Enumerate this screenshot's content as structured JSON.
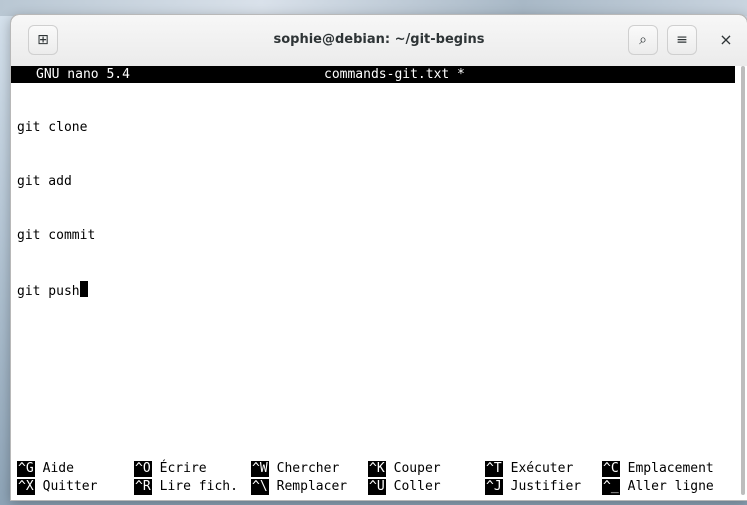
{
  "window": {
    "title": "sophie@debian: ~/git-begins"
  },
  "titlebar": {
    "new_tab_icon": "new-tab-icon",
    "search_icon": "search-icon",
    "menu_icon": "hamburger-menu-icon",
    "close_icon": "close-icon",
    "new_tab_glyph": "⊞",
    "search_glyph": "⌕",
    "menu_glyph": "≡",
    "close_glyph": "×"
  },
  "nano": {
    "version": "GNU nano 5.4",
    "filename": "commands-git.txt *"
  },
  "editor": {
    "lines": [
      "git clone",
      "git add",
      "git commit",
      "git push"
    ]
  },
  "shortcuts": [
    {
      "key": "^G",
      "label": "Aide"
    },
    {
      "key": "^O",
      "label": "Écrire"
    },
    {
      "key": "^W",
      "label": "Chercher"
    },
    {
      "key": "^K",
      "label": "Couper"
    },
    {
      "key": "^T",
      "label": "Exécuter"
    },
    {
      "key": "^C",
      "label": "Emplacement"
    },
    {
      "key": "^X",
      "label": "Quitter"
    },
    {
      "key": "^R",
      "label": "Lire fich."
    },
    {
      "key": "^\\",
      "label": "Remplacer"
    },
    {
      "key": "^U",
      "label": "Coller"
    },
    {
      "key": "^J",
      "label": "Justifier"
    },
    {
      "key": "^_",
      "label": "Aller ligne"
    }
  ],
  "colors": {
    "terminal_background": "#ffffff",
    "terminal_text": "#000000",
    "nano_header_background": "#000000",
    "shortcut_key_background": "#000000"
  }
}
